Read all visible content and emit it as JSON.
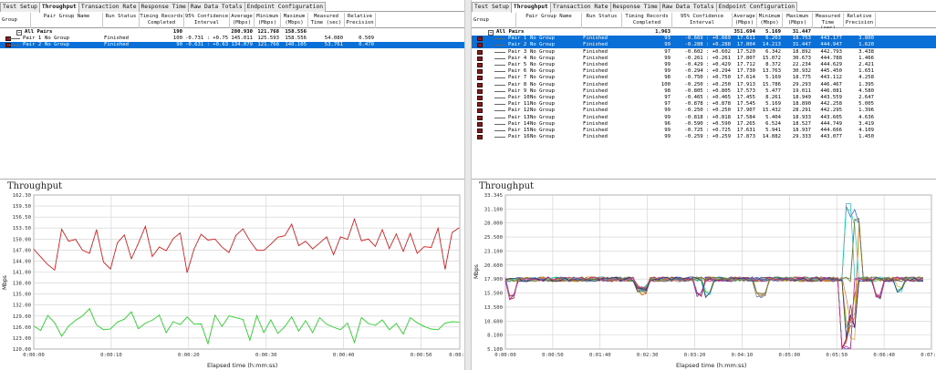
{
  "left": {
    "tabs": [
      {
        "label": "Test Setup",
        "active": false
      },
      {
        "label": "Throughput",
        "active": true
      },
      {
        "label": "Transaction Rate",
        "active": false
      },
      {
        "label": "Response Time",
        "active": false
      },
      {
        "label": "Raw Data Totals",
        "active": false
      },
      {
        "label": "Endpoint Configuration",
        "active": false
      }
    ],
    "columns": [
      "Group",
      "Pair Group Name",
      "Run Status",
      "Timing Records Completed",
      "95% Confidence Interval",
      "Average (Mbps)",
      "Minimum (Mbps)",
      "Maximum (Mbps)",
      "Measured Time (sec)",
      "Relative Precision"
    ],
    "summary": {
      "label": "All Pairs",
      "records": "190",
      "average": "280.930",
      "minimum": "121.768",
      "maximum": "158.556"
    },
    "rows": [
      {
        "pair": "Pair 1",
        "group": "No Group",
        "status": "Finished",
        "records": "100",
        "ci": "-0.731 : +0.753",
        "avg": "145.011",
        "min": "125.593",
        "max": "158.556",
        "time": "54.080",
        "prec": "0.509",
        "selected": false
      },
      {
        "pair": "Pair 2",
        "group": "No Group",
        "status": "Finished",
        "records": "90",
        "ci": "-0.631 : +0.631",
        "avg": "134.079",
        "min": "121.768",
        "max": "140.105",
        "time": "53.761",
        "prec": "0.470",
        "selected": true
      }
    ],
    "chart": {
      "title": "Throughput",
      "ylabel": "Mbps",
      "xlabel": "Elapsed time (h:mm:ss)"
    }
  },
  "right": {
    "tabs": [
      {
        "label": "Test Setup",
        "active": false
      },
      {
        "label": "Throughput",
        "active": true
      },
      {
        "label": "Transaction Rate",
        "active": false
      },
      {
        "label": "Response Time",
        "active": false
      },
      {
        "label": "Raw Data Totals",
        "active": false
      },
      {
        "label": "Endpoint Configuration",
        "active": false
      }
    ],
    "columns": [
      "Group",
      "Pair Group Name",
      "Run Status",
      "Timing Records Completed",
      "95% Confidence Interval",
      "Average (Mbps)",
      "Minimum (Mbps)",
      "Maximum (Mbps)",
      "Measured Time (sec)",
      "Relative Precision"
    ],
    "summary": {
      "label": "All Pairs",
      "records": "1,963",
      "average": "351.694",
      "minimum": "5.169",
      "maximum": "31.447"
    },
    "rows": [
      {
        "pair": "Pair 1",
        "group": "No Group",
        "status": "Finished",
        "records": "93",
        "ci": "-0.669 : +0.669",
        "avg": "17.611",
        "min": "6.263",
        "max": "18.753",
        "time": "443.177",
        "prec": "3.800",
        "selected": true
      },
      {
        "pair": "Pair 2",
        "group": "No Group",
        "status": "Finished",
        "records": "99",
        "ci": "-0.288 : +0.288",
        "avg": "17.804",
        "min": "14.213",
        "max": "31.447",
        "time": "444.947",
        "prec": "1.620",
        "selected": true
      },
      {
        "pair": "Pair 3",
        "group": "No Group",
        "status": "Finished",
        "records": "97",
        "ci": "-0.602 : +0.602",
        "avg": "17.520",
        "min": "6.342",
        "max": "18.892",
        "time": "442.793",
        "prec": "3.438",
        "selected": false
      },
      {
        "pair": "Pair 4",
        "group": "No Group",
        "status": "Finished",
        "records": "99",
        "ci": "-0.261 : +0.261",
        "avg": "17.807",
        "min": "15.072",
        "max": "30.673",
        "time": "444.788",
        "prec": "1.466",
        "selected": false
      },
      {
        "pair": "Pair 5",
        "group": "No Group",
        "status": "Finished",
        "records": "99",
        "ci": "-0.429 : +0.429",
        "avg": "17.712",
        "min": "8.372",
        "max": "22.234",
        "time": "444.629",
        "prec": "2.421",
        "selected": false
      },
      {
        "pair": "Pair 6",
        "group": "No Group",
        "status": "Finished",
        "records": "99",
        "ci": "-0.294 : +0.294",
        "avg": "17.730",
        "min": "13.763",
        "max": "30.932",
        "time": "445.450",
        "prec": "1.651",
        "selected": false
      },
      {
        "pair": "Pair 7",
        "group": "No Group",
        "status": "Finished",
        "records": "98",
        "ci": "-0.750 : +0.750",
        "avg": "17.614",
        "min": "5.169",
        "max": "18.775",
        "time": "443.112",
        "prec": "4.258",
        "selected": false
      },
      {
        "pair": "Pair 8",
        "group": "No Group",
        "status": "Finished",
        "records": "100",
        "ci": "-0.250 : +0.250",
        "avg": "17.913",
        "min": "15.786",
        "max": "29.293",
        "time": "446.467",
        "prec": "1.395",
        "selected": false
      },
      {
        "pair": "Pair 9",
        "group": "No Group",
        "status": "Finished",
        "records": "98",
        "ci": "-0.805 : +0.805",
        "avg": "17.573",
        "min": "5.477",
        "max": "19.011",
        "time": "446.081",
        "prec": "4.580",
        "selected": false
      },
      {
        "pair": "Pair 10",
        "group": "No Group",
        "status": "Finished",
        "records": "97",
        "ci": "-0.465 : +0.465",
        "avg": "17.455",
        "min": "8.261",
        "max": "18.949",
        "time": "443.559",
        "prec": "2.647",
        "selected": false
      },
      {
        "pair": "Pair 11",
        "group": "No Group",
        "status": "Finished",
        "records": "97",
        "ci": "-0.878 : +0.878",
        "avg": "17.545",
        "min": "5.169",
        "max": "18.890",
        "time": "442.258",
        "prec": "5.005",
        "selected": false
      },
      {
        "pair": "Pair 12",
        "group": "No Group",
        "status": "Finished",
        "records": "99",
        "ci": "-0.250 : +0.250",
        "avg": "17.907",
        "min": "15.432",
        "max": "28.291",
        "time": "442.295",
        "prec": "1.396",
        "selected": false
      },
      {
        "pair": "Pair 13",
        "group": "No Group",
        "status": "Finished",
        "records": "99",
        "ci": "-0.818 : +0.818",
        "avg": "17.584",
        "min": "5.404",
        "max": "18.933",
        "time": "443.605",
        "prec": "4.636",
        "selected": false
      },
      {
        "pair": "Pair 14",
        "group": "No Group",
        "status": "Finished",
        "records": "96",
        "ci": "-0.590 : +0.590",
        "avg": "17.265",
        "min": "6.524",
        "max": "18.527",
        "time": "444.749",
        "prec": "3.419",
        "selected": false
      },
      {
        "pair": "Pair 15",
        "group": "No Group",
        "status": "Finished",
        "records": "99",
        "ci": "-0.725 : +0.725",
        "avg": "17.631",
        "min": "5.941",
        "max": "18.937",
        "time": "444.666",
        "prec": "4.109",
        "selected": false
      },
      {
        "pair": "Pair 16",
        "group": "No Group",
        "status": "Finished",
        "records": "99",
        "ci": "-0.259 : +0.259",
        "avg": "17.873",
        "min": "14.882",
        "max": "29.333",
        "time": "443.077",
        "prec": "1.450",
        "selected": false
      }
    ],
    "chart": {
      "title": "Throughput",
      "ylabel": "Mbps",
      "xlabel": "Elapsed time (h:mm:ss)"
    }
  },
  "chart_data": [
    {
      "type": "line",
      "title": "Throughput",
      "xlabel": "Elapsed time (h:mm:ss)",
      "ylabel": "Mbps",
      "ylim": [
        120.0,
        162.3
      ],
      "yticks": [
        "162.30",
        "159.50",
        "156.50",
        "153.50",
        "150.00",
        "147.00",
        "144.00",
        "141.00",
        "138.00",
        "135.00",
        "132.00",
        "129.00",
        "126.00",
        "123.00",
        "120.00"
      ],
      "xticks": [
        "0:00:00",
        "0:00:10",
        "0:00:20",
        "0:00:30",
        "0:00:40",
        "0:00:50",
        "0:00:55"
      ],
      "xlim_sec": [
        0,
        55
      ],
      "colors": {
        "Pair 1": "#d42020",
        "Pair 2": "#2ad02a"
      },
      "series": [
        {
          "points": [
            [
              0,
              147.4
            ],
            [
              0.9,
              145.3
            ],
            [
              1.8,
              143.2
            ],
            [
              2.7,
              141.7
            ],
            [
              3.6,
              152.9
            ],
            [
              4.5,
              149.6
            ],
            [
              5.4,
              150.1
            ],
            [
              6.3,
              147.1
            ],
            [
              7.2,
              146.3
            ],
            [
              8.1,
              152.8
            ],
            [
              9.0,
              143.9
            ],
            [
              9.9,
              142.0
            ],
            [
              10.8,
              149.2
            ],
            [
              11.7,
              151.3
            ],
            [
              12.6,
              144.8
            ],
            [
              13.5,
              149.0
            ],
            [
              14.4,
              153.7
            ],
            [
              15.3,
              145.4
            ],
            [
              16.2,
              148.0
            ],
            [
              17.1,
              147.0
            ],
            [
              18.0,
              150.3
            ],
            [
              18.9,
              151.9
            ],
            [
              19.8,
              141.0
            ],
            [
              20.7,
              147.5
            ],
            [
              21.6,
              151.5
            ],
            [
              22.5,
              149.9
            ],
            [
              23.4,
              150.2
            ],
            [
              24.3,
              148.0
            ],
            [
              25.2,
              146.5
            ],
            [
              26.1,
              151.2
            ],
            [
              27.0,
              153.0
            ],
            [
              27.9,
              149.7
            ],
            [
              28.8,
              147.1
            ],
            [
              29.7,
              147.1
            ],
            [
              30.6,
              148.8
            ],
            [
              31.5,
              150.7
            ],
            [
              32.4,
              151.1
            ],
            [
              33.3,
              154.3
            ],
            [
              34.2,
              148.4
            ],
            [
              35.1,
              149.6
            ],
            [
              36.0,
              147.5
            ],
            [
              36.9,
              149.1
            ],
            [
              37.8,
              150.8
            ],
            [
              38.7,
              145.9
            ],
            [
              39.6,
              150.8
            ],
            [
              40.5,
              150.1
            ],
            [
              41.4,
              155.7
            ],
            [
              42.3,
              149.7
            ],
            [
              43.2,
              150.2
            ],
            [
              44.1,
              148.2
            ],
            [
              45.0,
              152.8
            ],
            [
              45.9,
              147.6
            ],
            [
              46.8,
              151.6
            ],
            [
              47.7,
              146.8
            ],
            [
              48.6,
              151.8
            ],
            [
              49.5,
              146.3
            ],
            [
              50.4,
              148.1
            ],
            [
              51.3,
              147.9
            ],
            [
              52.2,
              153.2
            ],
            [
              53.1,
              141.9
            ],
            [
              54.0,
              152.0
            ],
            [
              54.9,
              153.3
            ]
          ]
        },
        {
          "points": [
            [
              0,
              126.3
            ],
            [
              0.9,
              125.1
            ],
            [
              1.8,
              129.2
            ],
            [
              2.7,
              127.2
            ],
            [
              3.6,
              123.5
            ],
            [
              4.5,
              126.3
            ],
            [
              5.4,
              127.9
            ],
            [
              6.3,
              129.1
            ],
            [
              7.2,
              131.1
            ],
            [
              8.1,
              126.6
            ],
            [
              9.0,
              125.3
            ],
            [
              9.9,
              125.5
            ],
            [
              10.8,
              127.4
            ],
            [
              11.7,
              128.2
            ],
            [
              12.6,
              130.2
            ],
            [
              13.5,
              125.6
            ],
            [
              14.4,
              127.1
            ],
            [
              15.3,
              127.9
            ],
            [
              16.2,
              129.3
            ],
            [
              17.1,
              124.5
            ],
            [
              18.0,
              127.5
            ],
            [
              18.9,
              126.7
            ],
            [
              19.8,
              128.8
            ],
            [
              20.7,
              126.8
            ],
            [
              21.6,
              126.9
            ],
            [
              22.5,
              121.5
            ],
            [
              23.4,
              129.3
            ],
            [
              24.3,
              126.2
            ],
            [
              25.2,
              129.1
            ],
            [
              26.1,
              128.6
            ],
            [
              27.0,
              128.1
            ],
            [
              27.9,
              122.4
            ],
            [
              28.8,
              129.2
            ],
            [
              29.7,
              124.5
            ],
            [
              30.6,
              128.0
            ],
            [
              31.5,
              124.3
            ],
            [
              32.4,
              126.1
            ],
            [
              33.3,
              128.8
            ],
            [
              34.2,
              124.9
            ],
            [
              35.1,
              127.8
            ],
            [
              36.0,
              124.5
            ],
            [
              36.9,
              128.6
            ],
            [
              37.8,
              126.8
            ],
            [
              38.7,
              126.0
            ],
            [
              39.6,
              125.3
            ],
            [
              40.5,
              127.1
            ],
            [
              41.4,
              121.8
            ],
            [
              42.3,
              128.6
            ],
            [
              43.2,
              127.0
            ],
            [
              44.1,
              126.5
            ],
            [
              45.0,
              128.0
            ],
            [
              45.9,
              125.3
            ],
            [
              46.8,
              127.0
            ],
            [
              47.7,
              124.1
            ],
            [
              48.6,
              128.6
            ],
            [
              49.5,
              127.2
            ],
            [
              50.4,
              126.2
            ],
            [
              51.3,
              125.5
            ],
            [
              52.2,
              125.3
            ],
            [
              53.1,
              127.1
            ],
            [
              54.0,
              127.5
            ],
            [
              54.9,
              127.4
            ]
          ]
        }
      ]
    },
    {
      "type": "line",
      "title": "Throughput",
      "xlabel": "Elapsed time (h:mm:ss)",
      "ylabel": "Mbps",
      "ylim": [
        5.1,
        33.345
      ],
      "yticks": [
        "33.345",
        "31.100",
        "28.000",
        "25.500",
        "23.100",
        "20.600",
        "17.900",
        "15.500",
        "13.500",
        "10.600",
        "8.100",
        "5.100"
      ],
      "xticks": [
        "0:00:00",
        "0:00:50",
        "0:01:40",
        "0:02:30",
        "0:03:20",
        "0:04:10",
        "0:05:00",
        "0:05:50",
        "0:06:40",
        "0:07:30"
      ],
      "xlim_sec": [
        0,
        450
      ],
      "series_count": 16,
      "colors": [
        "#e23a3a",
        "#1f5fd1",
        "#2bb52b",
        "#d24bd2",
        "#e0a02a",
        "#27b7c9",
        "#8b4513",
        "#7a7a7a",
        "#b8b82a",
        "#4b2bd2",
        "#d2732b",
        "#2bd2a0",
        "#a02b60",
        "#607a2b",
        "#2b2b8b",
        "#c24b8b"
      ],
      "baseline": 17.9,
      "events": [
        {
          "t": 8,
          "v": 14.6
        },
        {
          "t": 142,
          "v": 16.0
        },
        {
          "t": 145,
          "v": 15.6
        },
        {
          "t": 205,
          "v": 15.3
        },
        {
          "t": 215,
          "v": 15.1
        },
        {
          "t": 270,
          "v": 15.0
        },
        {
          "t": 360,
          "v": 5.2
        },
        {
          "t": 364,
          "v": 31.4
        },
        {
          "t": 370,
          "v": 28.5
        },
        {
          "t": 395,
          "v": 14.9
        },
        {
          "t": 416,
          "v": 16.1
        }
      ]
    }
  ]
}
